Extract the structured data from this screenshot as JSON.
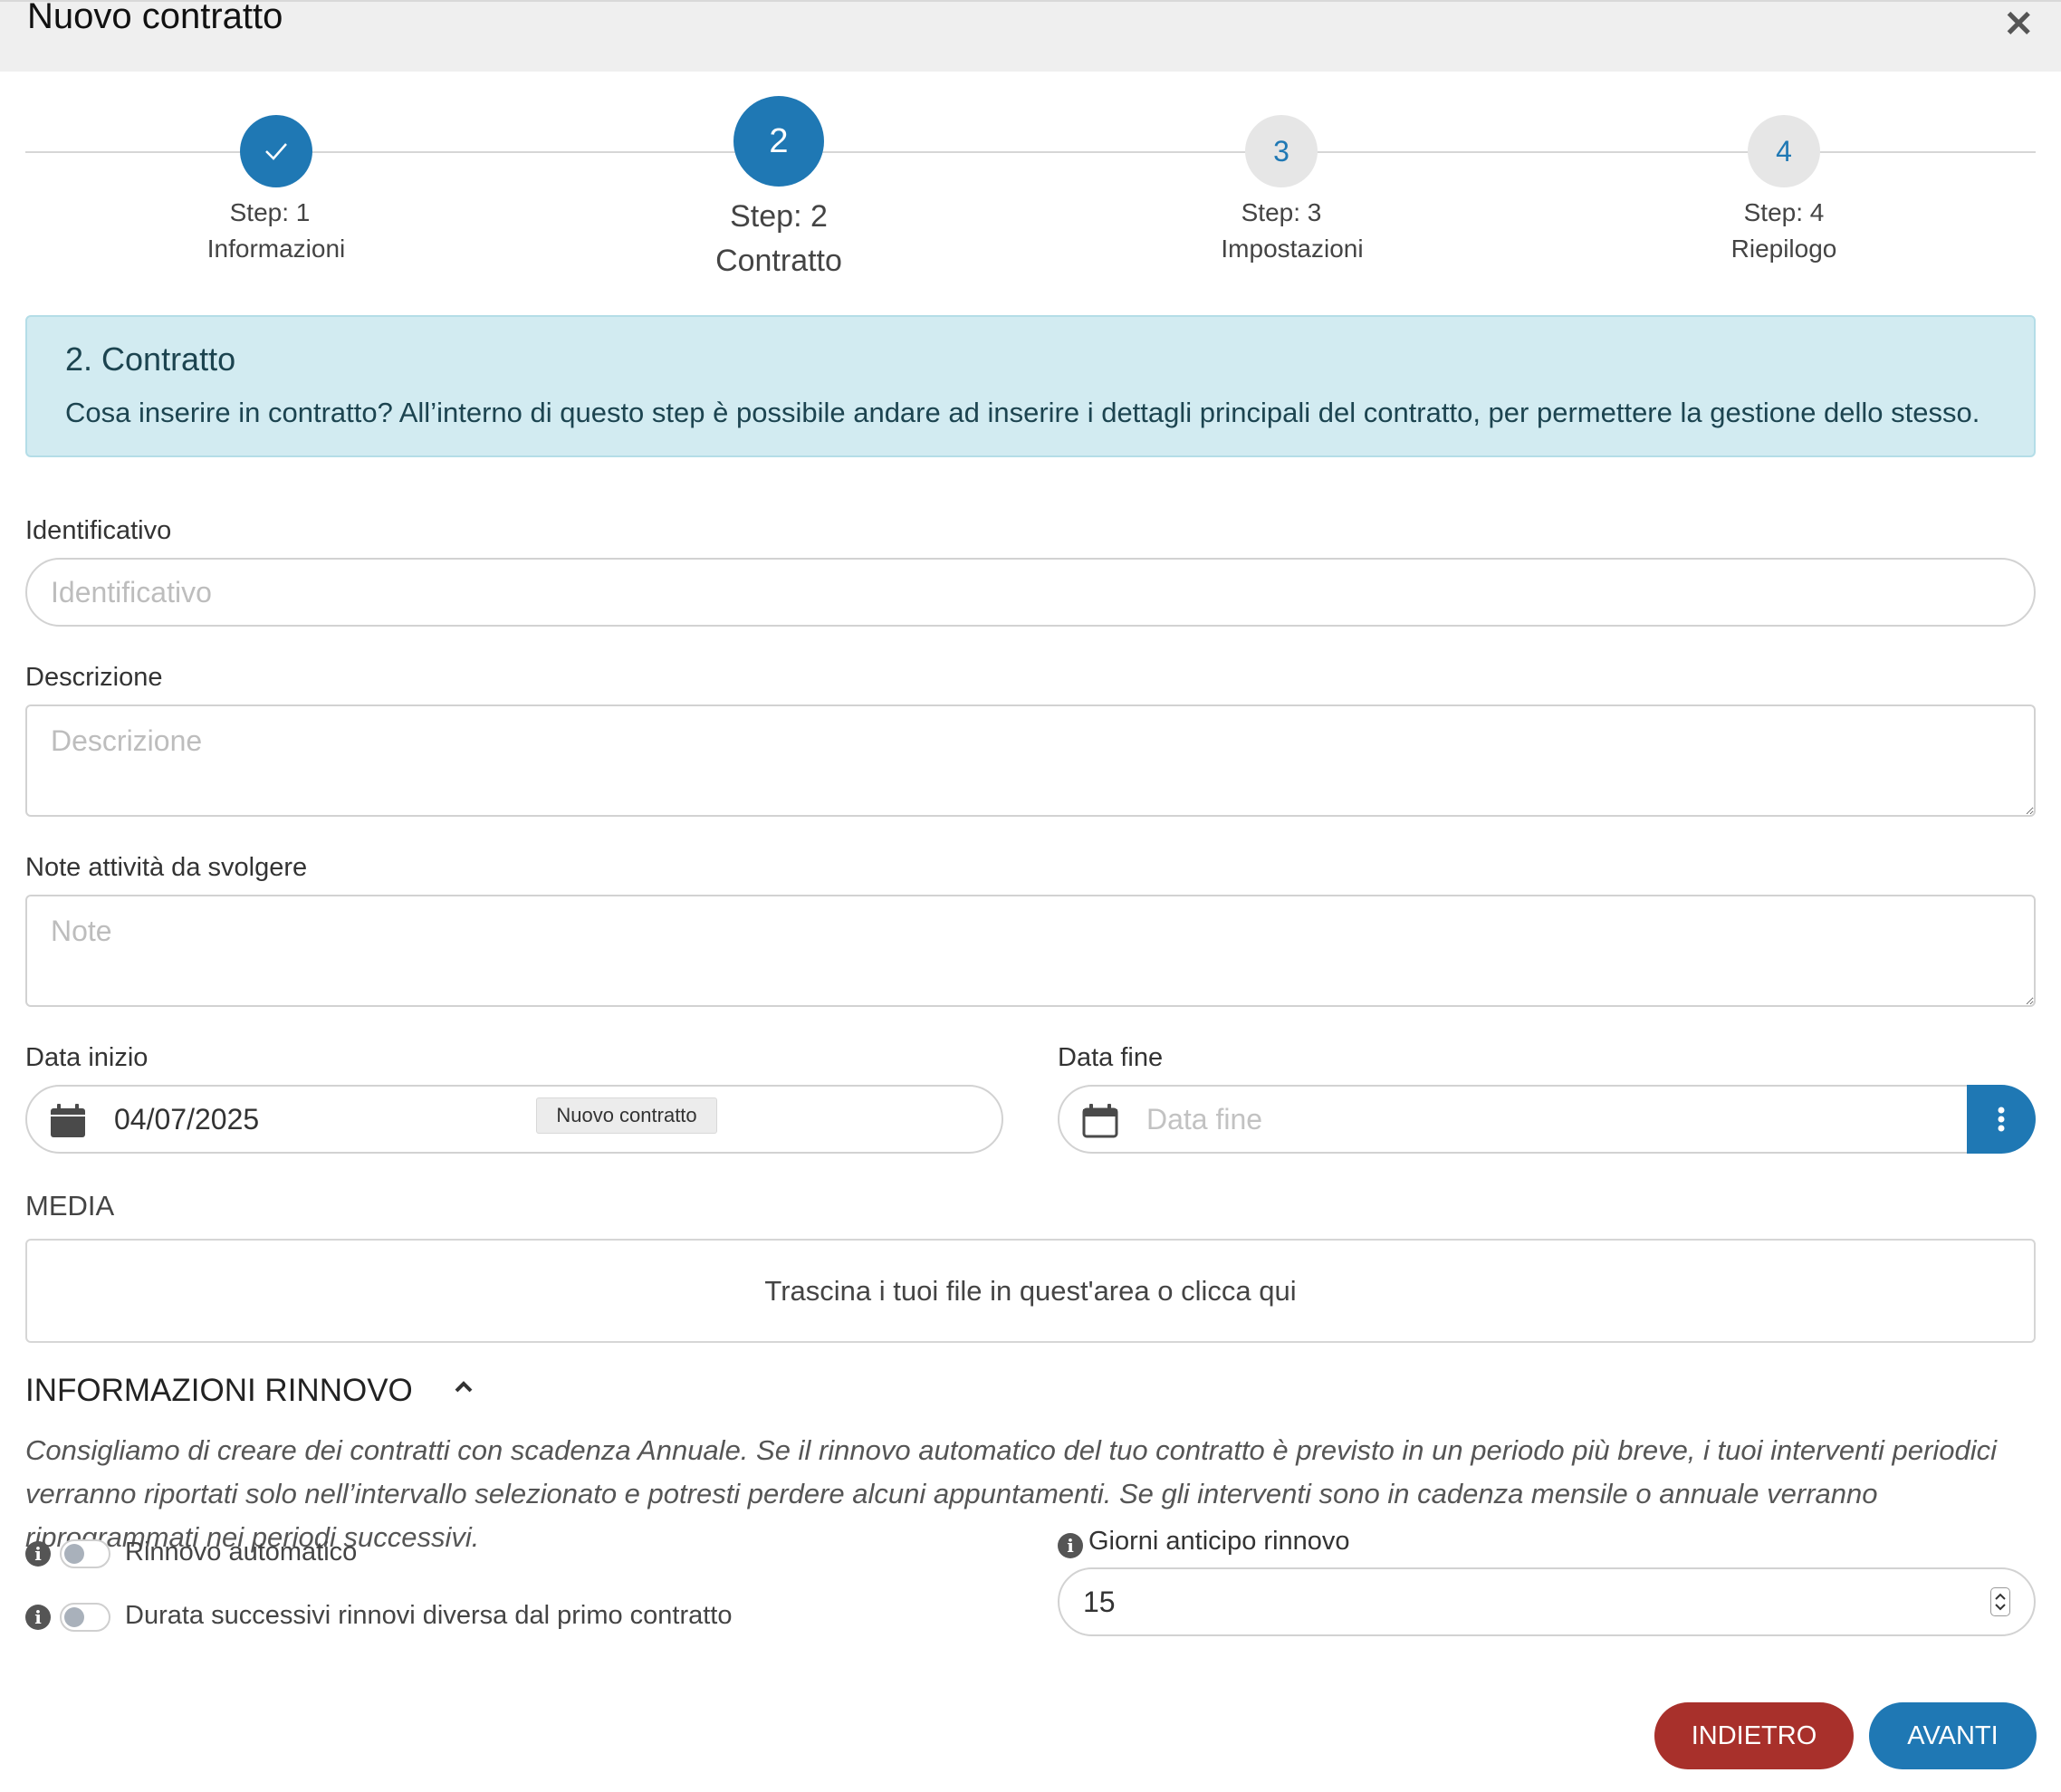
{
  "window": {
    "title": "Nuovo contratto",
    "close_symbol": "✕"
  },
  "steps": [
    {
      "number": "1",
      "state": "done",
      "label_step": "Step: 1",
      "label_name": "Informazioni"
    },
    {
      "number": "2",
      "state": "active",
      "label_step": "Step: 2",
      "label_name": "Contratto"
    },
    {
      "number": "3",
      "state": "todo",
      "label_step": "Step: 3",
      "label_name": "Impostazioni"
    },
    {
      "number": "4",
      "state": "todo",
      "label_step": "Step: 4",
      "label_name": "Riepilogo"
    }
  ],
  "info_box": {
    "title": "2. Contratto",
    "text": "Cosa inserire in contratto? All’interno di questo step è possibile andare ad inserire i dettagli principali del contratto, per permettere la gestione dello stesso."
  },
  "form": {
    "identificativo": {
      "label": "Identificativo",
      "placeholder": "Identificativo",
      "value": ""
    },
    "descrizione": {
      "label": "Descrizione",
      "placeholder": "Descrizione",
      "value": ""
    },
    "note": {
      "label": "Note attività da svolgere",
      "placeholder": "Note",
      "value": ""
    },
    "data_inizio": {
      "label": "Data inizio",
      "value": "04/07/2025",
      "tooltip": "Nuovo contratto"
    },
    "data_fine": {
      "label": "Data fine",
      "placeholder": "Data fine",
      "value": ""
    }
  },
  "media": {
    "label": "MEDIA",
    "dropzone_text": "Trascina i tuoi file in quest'area o clicca qui"
  },
  "renewal": {
    "title": "INFORMAZIONI RINNOVO",
    "description": "Consigliamo di creare dei contratti con scadenza Annuale. Se il rinnovo automatico del tuo contratto è previsto in un periodo più breve, i tuoi interventi periodici verranno riportati solo nell’intervallo selezionato e potresti perdere alcuni appuntamenti. Se gli interventi sono in cadenza mensile o annuale verranno riprogrammati nei periodi successivi.",
    "toggles": [
      {
        "label": "Rinnovo automatico",
        "checked": false
      },
      {
        "label": "Durata successivi rinnovi diversa dal primo contratto",
        "checked": false
      }
    ],
    "giorni_anticipo": {
      "label": "Giorni anticipo rinnovo",
      "value": "15"
    }
  },
  "buttons": {
    "back": "INDIETRO",
    "next": "AVANTI"
  },
  "colors": {
    "primary": "#1f78b4",
    "danger": "#a8302b",
    "info_bg": "#d2ebf1"
  }
}
